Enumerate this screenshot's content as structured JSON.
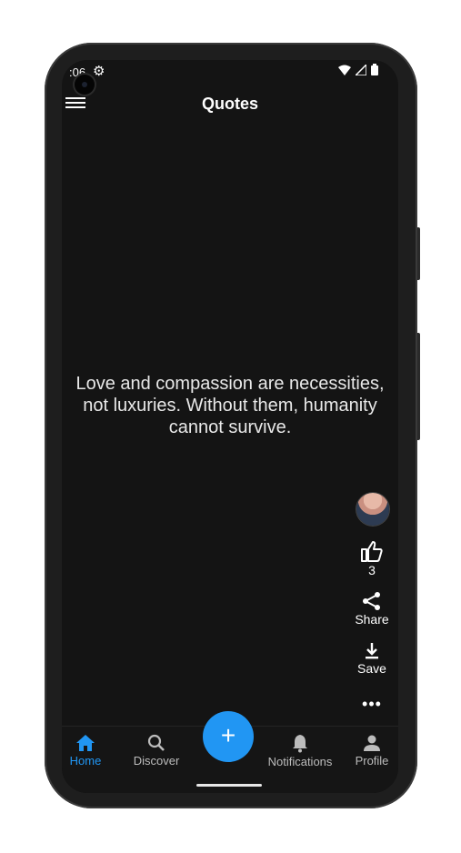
{
  "status": {
    "time": ":06"
  },
  "header": {
    "title": "Quotes"
  },
  "quote": {
    "text": "Love and compassion are necessities, not luxuries. Without them, humanity cannot survive."
  },
  "actions": {
    "like_count": "3",
    "share_label": "Share",
    "save_label": "Save",
    "more_label": "•••"
  },
  "fab": {
    "label": "+"
  },
  "bottom_nav": {
    "items": [
      {
        "label": "Home",
        "icon": "home-icon",
        "active": true
      },
      {
        "label": "Discover",
        "icon": "search-icon",
        "active": false
      },
      {
        "label": "Notifications",
        "icon": "bell-icon",
        "active": false
      },
      {
        "label": "Profile",
        "icon": "person-icon",
        "active": false
      }
    ]
  },
  "colors": {
    "accent": "#2196f3",
    "background": "#141414"
  }
}
